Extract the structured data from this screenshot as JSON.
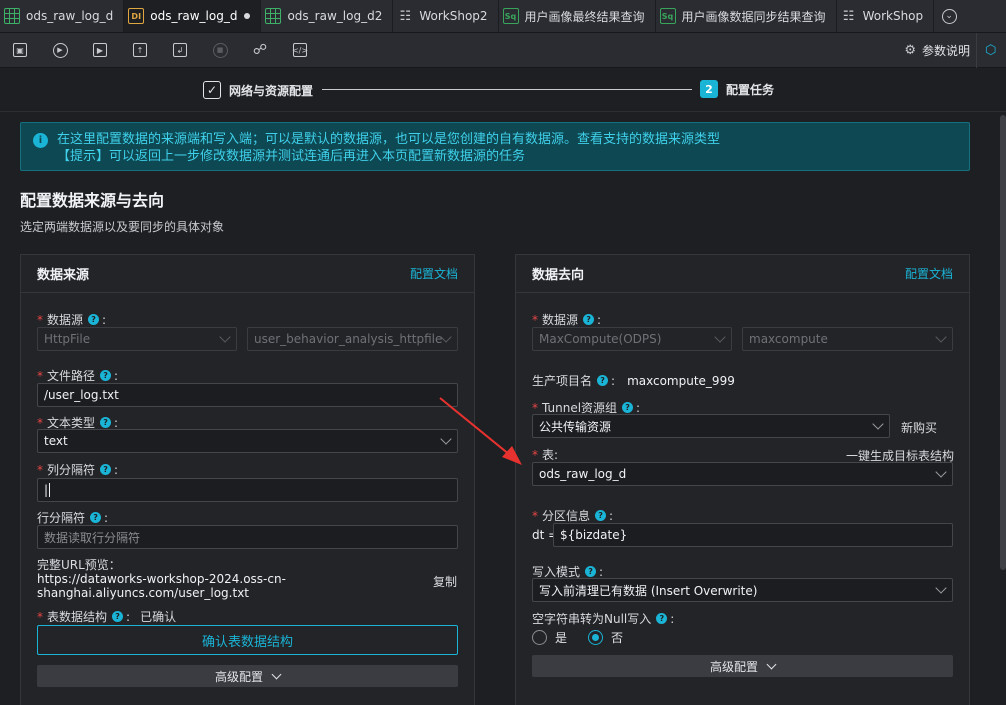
{
  "tabs": [
    {
      "label": "ods_raw_log_d",
      "icon": "table-icon"
    },
    {
      "label": "ods_raw_log_d",
      "icon": "di-icon",
      "active": true,
      "modified": true
    },
    {
      "label": "ods_raw_log_d2",
      "icon": "table-icon"
    },
    {
      "label": "WorkShop2",
      "icon": "workflow-icon"
    },
    {
      "label": "用户画像最终结果查询",
      "icon": "sql-icon"
    },
    {
      "label": "用户画像数据同步结果查询",
      "icon": "sql-icon"
    },
    {
      "label": "WorkShop",
      "icon": "workflow-icon"
    }
  ],
  "tab_icon_text": {
    "di": "DI",
    "sq": "Sq"
  },
  "toolbar": {
    "tools": [
      "save-icon",
      "run-icon",
      "run-params-icon",
      "submit-icon",
      "deploy-icon",
      "stop-icon",
      "lineage-icon",
      "code-icon"
    ],
    "params_label": "参数说明"
  },
  "steps": {
    "step1": "网络与资源配置",
    "step2_num": "2",
    "step2": "配置任务"
  },
  "banner": {
    "line1": "在这里配置数据的来源端和写入端；可以是默认的数据源，也可以是您创建的自有数据源。查看支持的数据来源类型",
    "line2": "【提示】可以返回上一步修改数据源并测试连通后再进入本页配置新数据源的任务"
  },
  "section": {
    "title": "配置数据来源与去向",
    "subtitle": "选定两端数据源以及要同步的具体对象"
  },
  "source": {
    "title": "数据来源",
    "doc_link": "配置文档",
    "datasource_label": "数据源",
    "datasource_type": "HttpFile",
    "datasource_name": "user_behavior_analysis_httpfile",
    "path_label": "文件路径",
    "path_value": "/user_log.txt",
    "filetype_label": "文本类型",
    "filetype_value": "text",
    "col_sep_label": "列分隔符",
    "col_sep_value": "|",
    "row_sep_label": "行分隔符",
    "row_sep_placeholder": "数据读取行分隔符",
    "url_label": "完整URL预览：",
    "url_line1": "https://dataworks-workshop-2024.oss-cn-",
    "url_line2": "shanghai.aliyuncs.com/user_log.txt",
    "copy_link": "复制",
    "schema_label": "表数据结构",
    "schema_status": "已确认",
    "confirm_button": "确认表数据结构",
    "advanced_button": "高级配置"
  },
  "target": {
    "title": "数据去向",
    "doc_link": "配置文档",
    "datasource_label": "数据源",
    "datasource_type": "MaxCompute(ODPS)",
    "datasource_name": "maxcompute",
    "project_label": "生产项目名",
    "project_value": "maxcompute_999",
    "tunnel_label": "Tunnel资源组",
    "tunnel_value": "公共传输资源",
    "buy_link": "新购买",
    "table_label": "表",
    "gen_link": "一键生成目标表结构",
    "table_value": "ods_raw_log_d",
    "partition_label": "分区信息",
    "partition_key": "dt =",
    "partition_value": "${bizdate}",
    "write_mode_label": "写入模式",
    "write_mode_value": "写入前清理已有数据 (Insert Overwrite)",
    "null_label": "空字符串转为Null写入",
    "yes": "是",
    "no": "否",
    "advanced_button": "高级配置"
  }
}
